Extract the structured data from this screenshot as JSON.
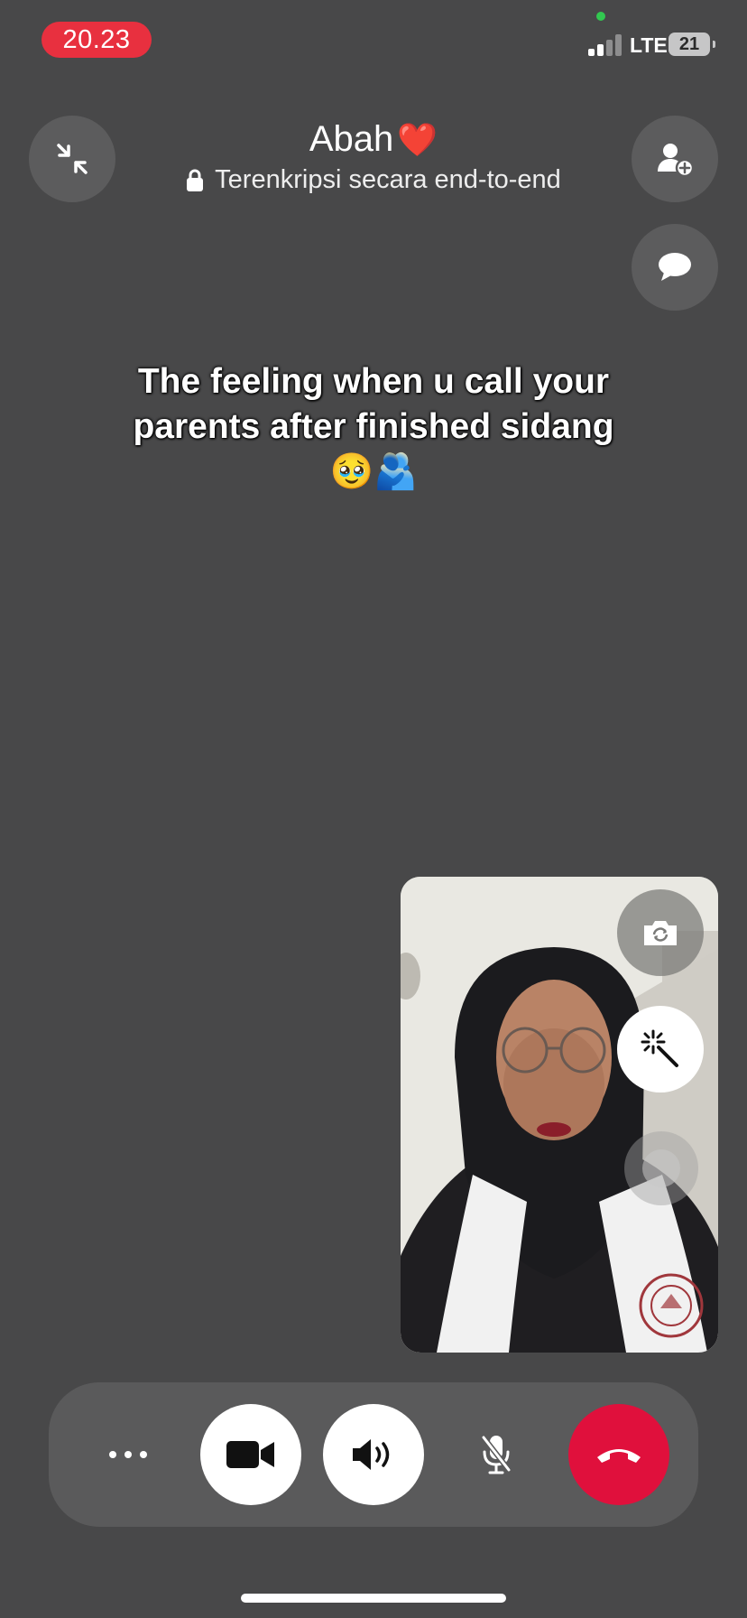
{
  "status_bar": {
    "time": "20.23",
    "network": "LTE",
    "battery": "21"
  },
  "call": {
    "contact_name": "Abah",
    "contact_emoji": "❤️",
    "encryption_text": "Terenkripsi secara end-to-end"
  },
  "overlay_caption": {
    "text": "The feeling when u call your parents after finished sidang",
    "emojis": "🥹🫂"
  },
  "icons": {
    "minimize": "minimize-icon",
    "add_person": "add-person-icon",
    "chat": "chat-bubble-icon",
    "flip_camera": "flip-camera-icon",
    "effects": "magic-wand-icon",
    "more": "more-dots-icon",
    "video": "video-camera-icon",
    "speaker": "speaker-icon",
    "mic_off": "mic-off-icon",
    "end_call": "end-call-icon"
  },
  "colors": {
    "background": "#484849",
    "time_pill": "#e8303f",
    "end_call": "#e0103c",
    "camera_dot": "#32c850"
  }
}
